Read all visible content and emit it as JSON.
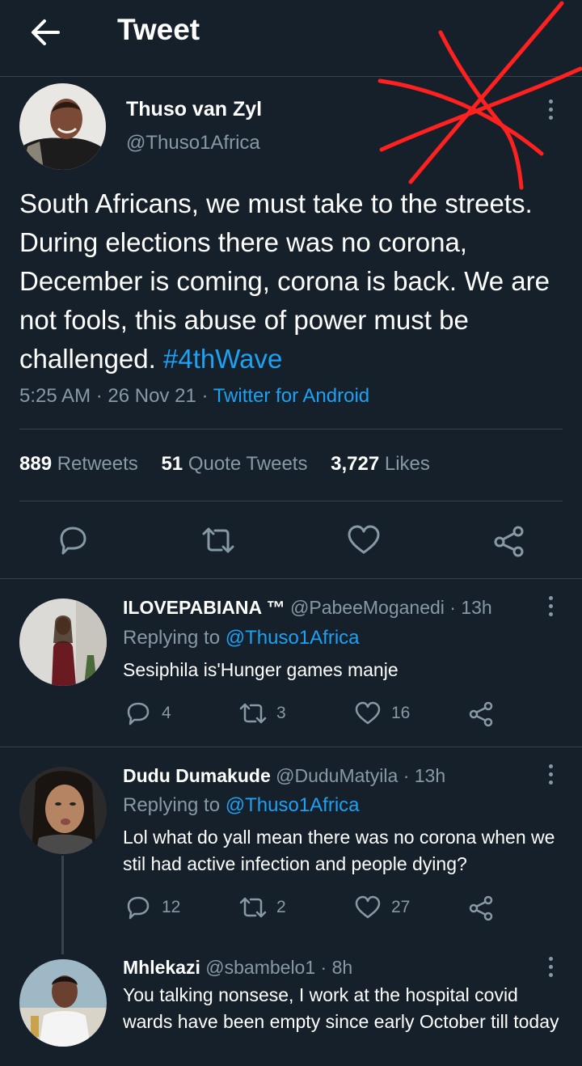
{
  "header": {
    "title": "Tweet",
    "back_icon": "arrow-left-icon"
  },
  "tweet": {
    "author": {
      "name": "Thuso van Zyl",
      "handle": "@Thuso1Africa"
    },
    "text": "South Africans, we must take to the streets. During elections there was no corona, December is coming, corona is back. We are not fools, this abuse of power must be challenged.",
    "hashtag": "#4thWave",
    "time": "5:25 AM",
    "date": "26 Nov 21",
    "source": "Twitter for Android",
    "stats": {
      "retweets": "889",
      "retweets_label": "Retweets",
      "quotes": "51",
      "quotes_label": "Quote Tweets",
      "likes": "3,727",
      "likes_label": "Likes"
    }
  },
  "replies": [
    {
      "name": "ILOVEPABIANA ™",
      "handle": "@PabeeMoganedi",
      "time": "13h",
      "replying_label": "Replying to",
      "replying_to": "@Thuso1Africa",
      "text": "Sesiphila is'Hunger games manje",
      "replies": "4",
      "retweets": "3",
      "likes": "16"
    },
    {
      "name": "Dudu Dumakude",
      "handle": "@DuduMatyila",
      "time": "13h",
      "replying_label": "Replying to",
      "replying_to": "@Thuso1Africa",
      "text": "Lol what do yall mean there was no corona when we stil had active infection and people dying?",
      "replies": "12",
      "retweets": "2",
      "likes": "27"
    },
    {
      "name": "Mhlekazi",
      "handle": "@sbambelo1",
      "time": "8h",
      "text": "You talking nonsese, I work at the hospital  covid wards have been empty since early October till today"
    }
  ],
  "colors": {
    "background": "#15202b",
    "accent": "#1da1f2",
    "muted": "#8899a6",
    "divider": "#38444d",
    "scribble": "#ff2020"
  }
}
